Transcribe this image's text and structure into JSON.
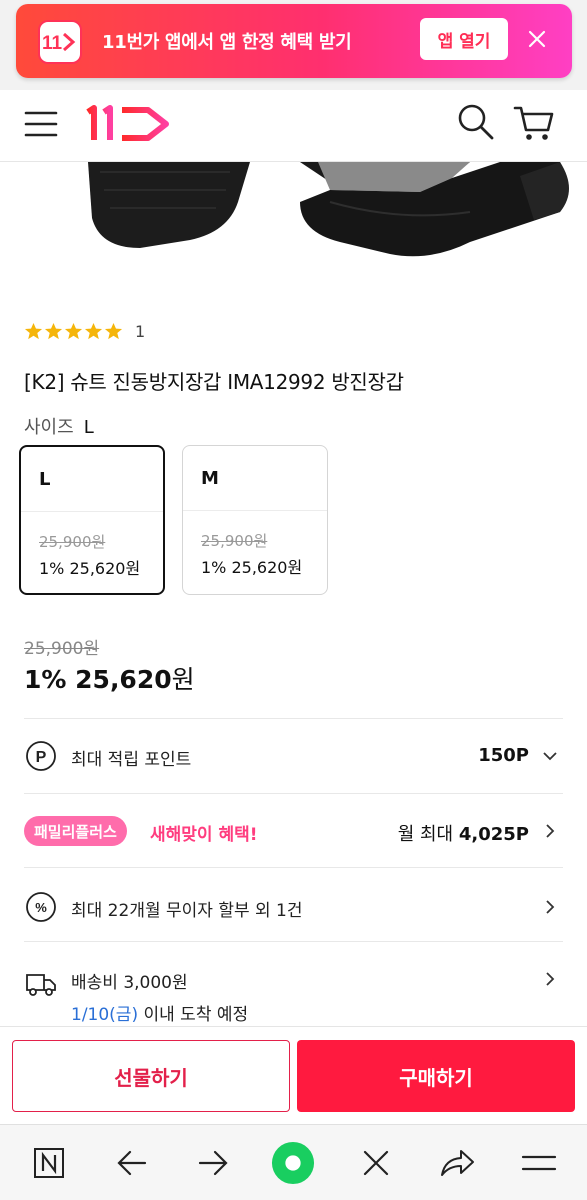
{
  "promo": {
    "text": "11번가 앱에서 앱 한정 혜택 받기",
    "open_label": "앱 열기",
    "accent": "#ff2d55"
  },
  "header": {
    "logo_text": "11",
    "icons": [
      "menu-icon",
      "search-icon",
      "cart-icon"
    ]
  },
  "product": {
    "rating_stars": 5,
    "rating_count": "1",
    "title": "[K2] 슈트 진동방지장갑 IMA12992 방진장갑",
    "size_label": "사이즈",
    "size_value": "L",
    "options": [
      {
        "name": "L",
        "original_price": "25,900원",
        "price": "1% 25,620원",
        "selected": true
      },
      {
        "name": "M",
        "original_price": "25,900원",
        "price": "1% 25,620원",
        "selected": false
      }
    ],
    "original_price": "25,900원",
    "sale_price": "1% 25,620",
    "sale_unit": "원"
  },
  "benefits": {
    "points_label": "최대 적립 포인트",
    "points_value": "150P",
    "family_badge": "패밀리플러스",
    "family_text": "새해맞이 혜택!",
    "family_prefix": "월 최대",
    "family_value": "4,025P",
    "installment_label": "최대 22개월 무이자 할부 외 1건",
    "shipping_label": "배송비 3,000원",
    "arrival_date": "1/10(금)",
    "arrival_text": "이내 도착 예정"
  },
  "buy_bar": {
    "gift_label": "선물하기",
    "buy_label": "구매하기",
    "buy_color": "#ff1a3f"
  },
  "browser_nav": {
    "icons": [
      "naver-icon",
      "back-arrow-icon",
      "forward-arrow-icon",
      "home-circle-icon",
      "close-icon",
      "share-icon",
      "menu-icon"
    ],
    "accent": "#19ce60"
  }
}
